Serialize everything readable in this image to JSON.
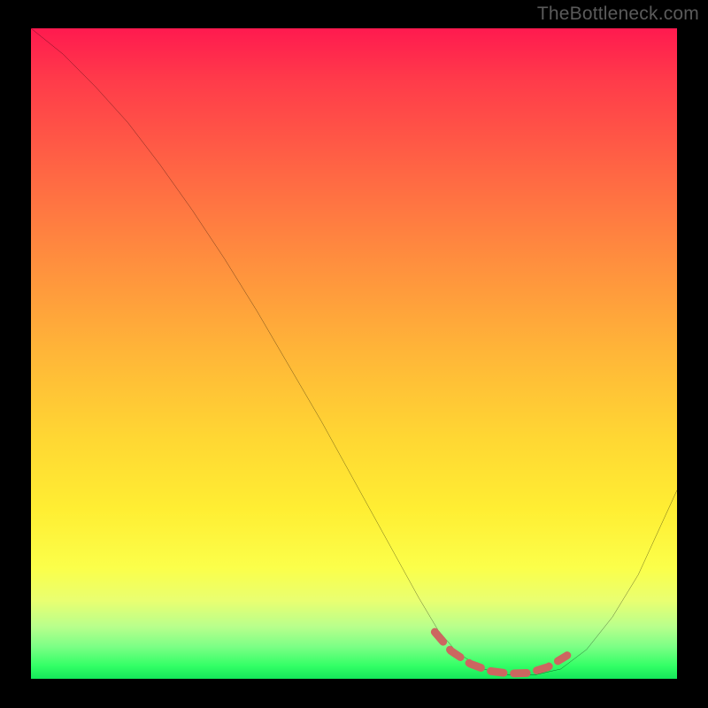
{
  "watermark": "TheBottleneck.com",
  "chart_data": {
    "type": "line",
    "title": "",
    "xlabel": "",
    "ylabel": "",
    "xlim": [
      0,
      100
    ],
    "ylim": [
      0,
      100
    ],
    "series": [
      {
        "name": "bottleneck-curve",
        "color": "#000000",
        "x": [
          0,
          5,
          10,
          15,
          20,
          25,
          30,
          35,
          40,
          45,
          50,
          55,
          60,
          63,
          66,
          70,
          74,
          78,
          82,
          86,
          90,
          94,
          100
        ],
        "y": [
          100,
          96,
          91,
          85.5,
          79,
          72,
          64.5,
          56.5,
          48,
          39.5,
          30.5,
          21.5,
          12.5,
          7.5,
          4,
          1.5,
          0.6,
          0.6,
          1.5,
          4.5,
          9.5,
          16,
          29
        ]
      },
      {
        "name": "highlight-band",
        "color": "#cc6660",
        "stroke_width": 9,
        "dash": "14 10",
        "x": [
          62.5,
          65,
          68,
          71,
          74,
          77,
          80,
          83
        ],
        "y": [
          7.2,
          4.3,
          2.3,
          1.2,
          0.8,
          0.9,
          1.8,
          3.6
        ]
      }
    ],
    "gradient_stops": [
      {
        "pos": 0,
        "color": "#ff1a4f"
      },
      {
        "pos": 8,
        "color": "#ff3b4a"
      },
      {
        "pos": 22,
        "color": "#ff6644"
      },
      {
        "pos": 36,
        "color": "#ff8f3e"
      },
      {
        "pos": 50,
        "color": "#ffb638"
      },
      {
        "pos": 63,
        "color": "#ffd733"
      },
      {
        "pos": 74,
        "color": "#ffee33"
      },
      {
        "pos": 83,
        "color": "#fbff4a"
      },
      {
        "pos": 88,
        "color": "#e9ff71"
      },
      {
        "pos": 92,
        "color": "#b8ff8c"
      },
      {
        "pos": 95,
        "color": "#7dff86"
      },
      {
        "pos": 98,
        "color": "#33ff66"
      },
      {
        "pos": 100,
        "color": "#14e85a"
      }
    ]
  }
}
